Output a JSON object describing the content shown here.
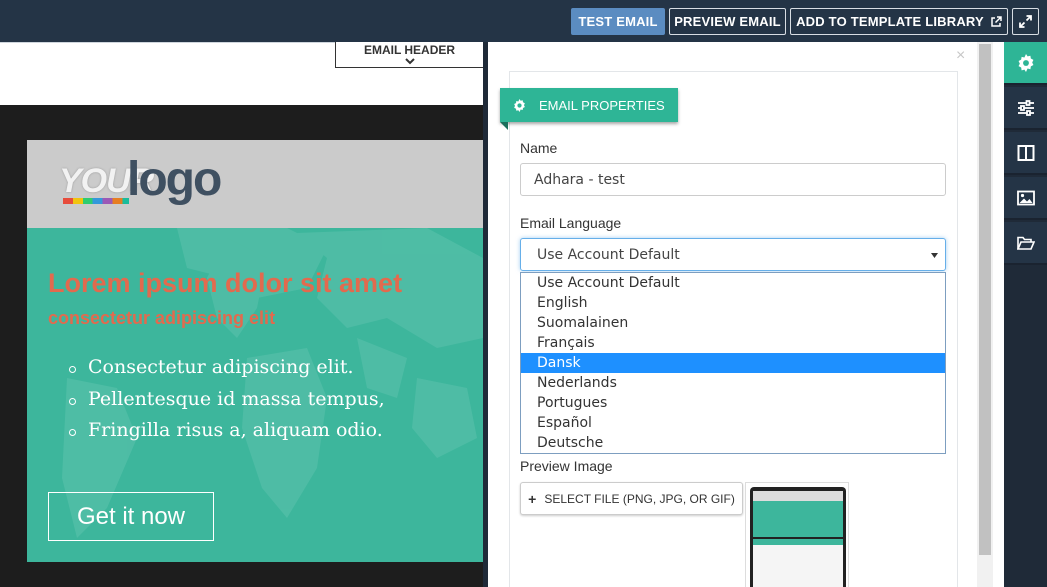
{
  "topbar": {
    "test_email": "TEST EMAIL",
    "preview_email": "PREVIEW EMAIL",
    "add_template": "ADD TO TEMPLATE LIBRARY"
  },
  "canvas": {
    "header_tab": "EMAIL HEADER",
    "logo_your": "YOUR",
    "logo_logo": "logo",
    "hero_title": "Lorem ipsum dolor sit amet",
    "hero_sub": "consectetur adipiscing elit",
    "list": [
      "Consectetur adipiscing elit.",
      "Pellentesque id massa tempus,",
      "Fringilla risus a, aliquam odio."
    ],
    "cta": "Get it now"
  },
  "panel": {
    "section_title": "EMAIL PROPERTIES",
    "name_label": "Name",
    "name_value": "Adhara - test",
    "language_label": "Email Language",
    "language_value": "Use Account Default",
    "language_options": [
      "Use Account Default",
      "English",
      "Suomalainen",
      "Français",
      "Dansk",
      "Nederlands",
      "Portugues",
      "Español",
      "Deutsche"
    ],
    "highlighted_option_index": 4,
    "preview_label": "Preview Image",
    "select_file": "SELECT FILE (PNG, JPG, OR GIF)",
    "close": "×"
  },
  "colors": {
    "accent": "#2eb596",
    "hero_bg": "#3db69c",
    "hero_text": "#e26a4e",
    "topbar": "#243446",
    "primary_btn": "#5b8cc1",
    "highlight": "#1e90ff"
  },
  "sidebar": {
    "icons": [
      "gear-icon",
      "sliders-icon",
      "columns-icon",
      "image-icon",
      "folder-open-icon"
    ],
    "active_index": 0
  }
}
